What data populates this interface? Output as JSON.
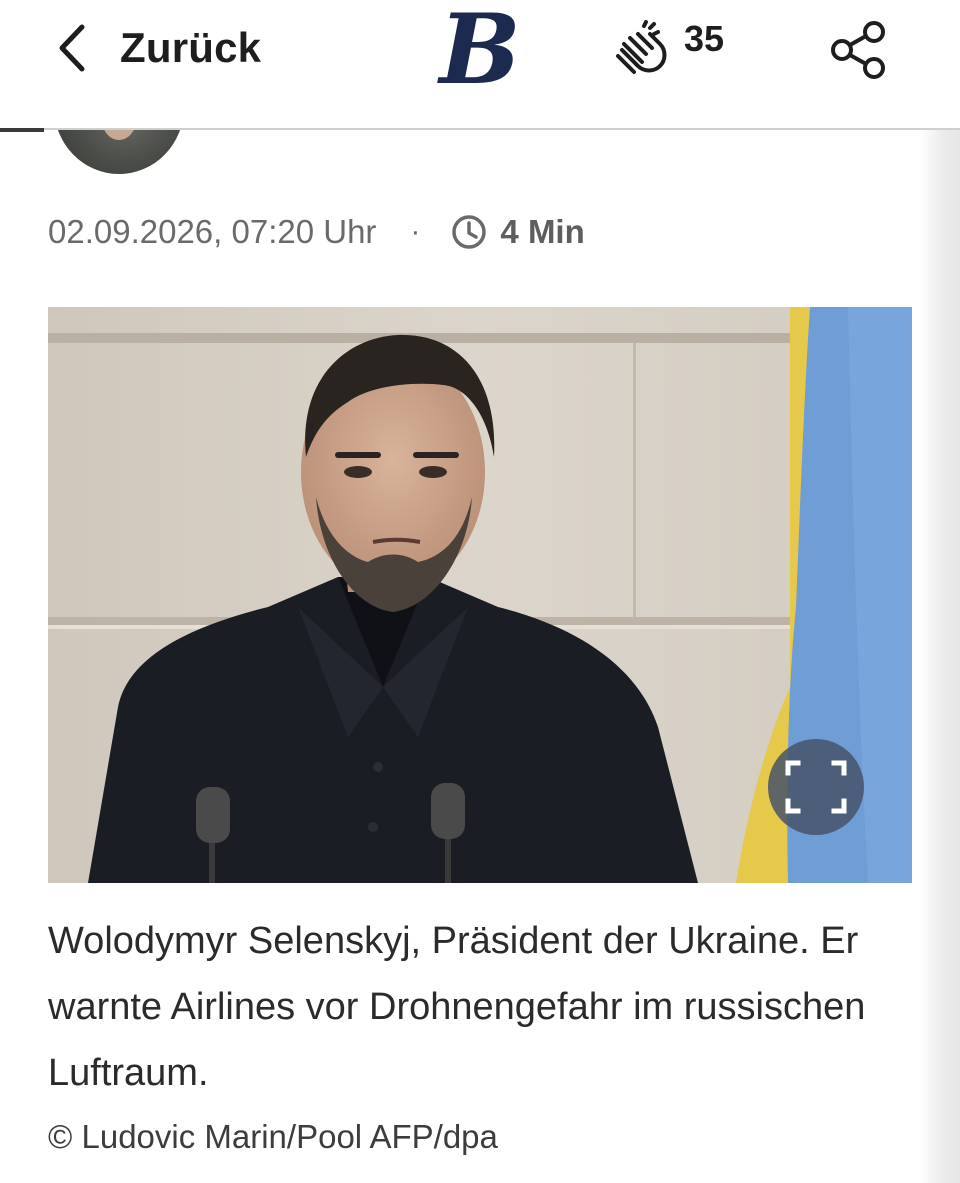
{
  "header": {
    "back_label": "Zurück",
    "logo_letter": "B",
    "applause_count": "35"
  },
  "meta": {
    "date": "02.09.2026, 07:20 Uhr",
    "separator": "·",
    "read_time": "4 Min"
  },
  "photo": {
    "caption": "Wolodymyr Selenskyj, Präsident der Ukraine. Er warnte Airlines vor Drohnengefahr im russischen Luftraum.",
    "credit": "© Ludovic Marin/Pool AFP/dpa"
  },
  "colors": {
    "logo": "#1c2a4f",
    "flag_blue": "#6f9ed6",
    "flag_yellow": "#e6c94a",
    "expand_button": "#465268"
  }
}
